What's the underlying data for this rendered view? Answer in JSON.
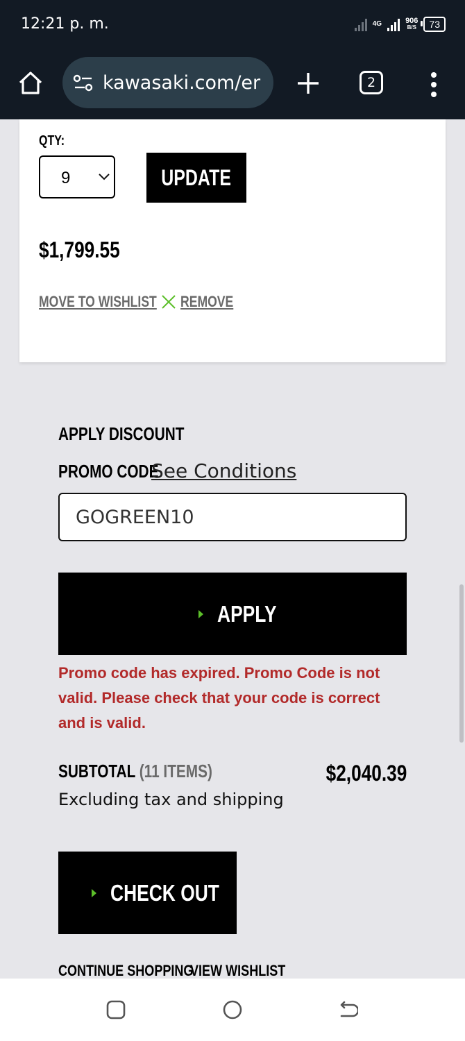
{
  "status_bar": {
    "time": "12:21 p. m.",
    "network": "4G",
    "speed_value": "906",
    "speed_unit": "B/S",
    "battery": "73"
  },
  "browser": {
    "url": "kawasaki.com/er",
    "tab_count": "2",
    "icons": [
      "home-icon",
      "site-settings-icon",
      "plus-icon",
      "tabs-icon",
      "more-vert-icon"
    ]
  },
  "cart_item": {
    "qty_label": "QTY:",
    "qty_value": "9",
    "update_label": "UPDATE",
    "price": "$1,799.55",
    "move_to_wishlist": "MOVE TO WISHLIST",
    "remove": "REMOVE",
    "remove_icon_color": "#5cbf2a"
  },
  "discount": {
    "heading": "APPLY DISCOUNT",
    "promo_label": "PROMO CODE",
    "see_conditions": "See Conditions",
    "promo_value": "GOGREEN10",
    "apply_label": "APPLY",
    "error": "Promo code has expired. Promo Code is not valid. Please check that your code is correct and is valid.",
    "error_color": "#b22a2a"
  },
  "summary": {
    "subtotal_label": "SUBTOTAL",
    "items_count": "(11 ITEMS)",
    "subtotal_amount": "$2,040.39",
    "note": "Excluding tax and shipping",
    "checkout_label": "CHECK OUT",
    "continue_shopping": "CONTINUE SHOPPING",
    "view_wishlist": "VIEW WISHLIST"
  },
  "accent_color": "#5cbf2a"
}
